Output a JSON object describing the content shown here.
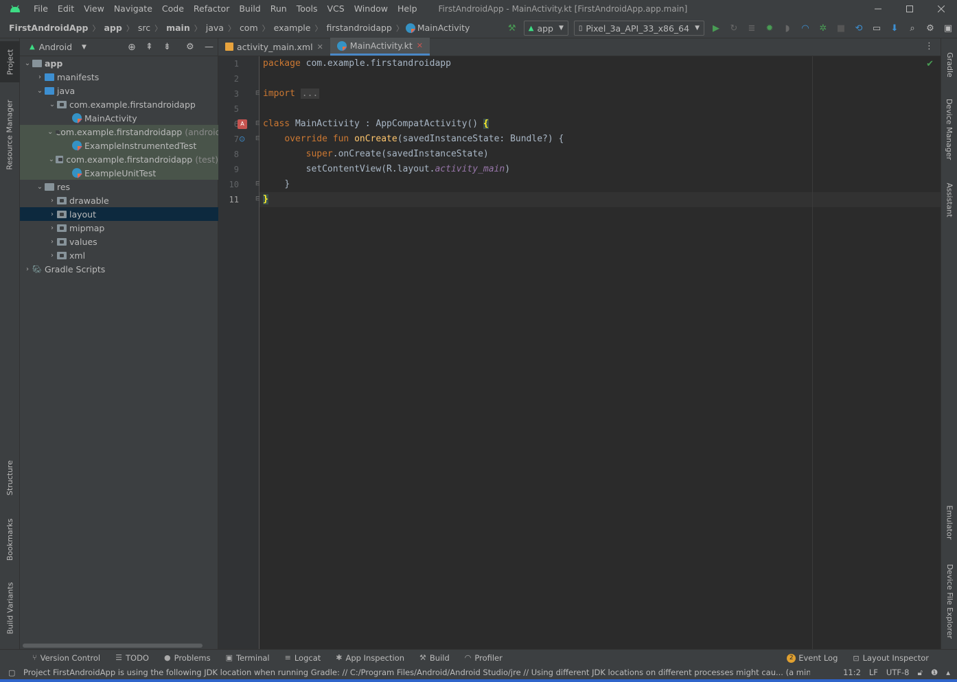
{
  "window": {
    "title": "FirstAndroidApp - MainActivity.kt [FirstAndroidApp.app.main]",
    "menu": [
      "File",
      "Edit",
      "View",
      "Navigate",
      "Code",
      "Refactor",
      "Build",
      "Run",
      "Tools",
      "VCS",
      "Window",
      "Help"
    ]
  },
  "breadcrumb": [
    "FirstAndroidApp",
    "app",
    "src",
    "main",
    "java",
    "com",
    "example",
    "firstandroidapp",
    "MainActivity"
  ],
  "toolbar": {
    "run_config": "app",
    "device": "Pixel_3a_API_33_x86_64"
  },
  "project_panel": {
    "view_mode": "Android",
    "tree": {
      "app": "app",
      "manifests": "manifests",
      "java": "java",
      "pkg_main": "com.example.firstandroidapp",
      "main_activity": "MainActivity",
      "pkg_android_test": "com.example.firstandroidapp",
      "pkg_android_test_suffix": "(androidT",
      "instrumented_test": "ExampleInstrumentedTest",
      "pkg_test": "com.example.firstandroidapp",
      "pkg_test_suffix": "(test)",
      "unit_test": "ExampleUnitTest",
      "res": "res",
      "drawable": "drawable",
      "layout": "layout",
      "mipmap": "mipmap",
      "values": "values",
      "xml": "xml",
      "gradle_scripts": "Gradle Scripts"
    }
  },
  "left_tool_windows": [
    "Project",
    "Resource Manager",
    "Structure",
    "Bookmarks",
    "Build Variants"
  ],
  "right_tool_windows": [
    "Gradle",
    "Device Manager",
    "Assistant",
    "Emulator",
    "Device File Explorer"
  ],
  "editor_tabs": [
    {
      "label": "activity_main.xml",
      "active": false
    },
    {
      "label": "MainActivity.kt",
      "active": true
    }
  ],
  "line_numbers": [
    "1",
    "2",
    "3",
    "5",
    "6",
    "7",
    "8",
    "9",
    "10",
    "11"
  ],
  "code": {
    "l1_kw": "package",
    "l1_rest": " com.example.firstandroidapp",
    "l3_kw": "import",
    "l3_fold": "...",
    "l6_kw": "class",
    "l6_rest": " MainActivity : AppCompatActivity() ",
    "l6_brace": "{",
    "l7_kw1": "override",
    "l7_kw2": "fun",
    "l7_fn": "onCreate",
    "l7_rest": "(savedInstanceState: Bundle?) {",
    "l8_kw": "super",
    "l8_rest": ".onCreate(savedInstanceState)",
    "l9_a": "setContentView(R.layout.",
    "l9_it": "activity_main",
    "l9_b": ")",
    "l10": "}",
    "l11": "}"
  },
  "bottom_tools": [
    "Version Control",
    "TODO",
    "Problems",
    "Terminal",
    "Logcat",
    "App Inspection",
    "Build",
    "Profiler"
  ],
  "bottom_right_tools": {
    "event_log_count": "2",
    "event_log": "Event Log",
    "layout_inspector": "Layout Inspector"
  },
  "status": {
    "message": "Project FirstAndroidApp is using the following JDK location when running Gradle: // C:/Program Files/Android/Android Studio/jre // Using different JDK locations on different processes might cau... (a minute ago)",
    "position": "11:2",
    "line_sep": "LF",
    "encoding": "UTF-8"
  },
  "colors": {
    "accent": "#4a88c7",
    "bg_editor": "#2b2b2b",
    "bg_panel": "#3c3f41",
    "keyword": "#cc7832",
    "function": "#ffc66d",
    "android_green": "#3ddc84",
    "run_green": "#499c54"
  }
}
